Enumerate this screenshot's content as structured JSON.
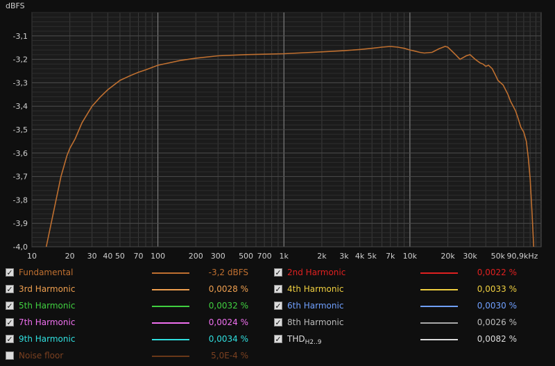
{
  "chart_data": {
    "type": "line",
    "ylabel": "dBFS",
    "x_scale": "log",
    "xlim": [
      10,
      110000
    ],
    "ylim": [
      -4.0,
      -3.0
    ],
    "y_ticks": [
      "-3,1",
      "-3,2",
      "-3,3",
      "-3,4",
      "-3,5",
      "-3,6",
      "-3,7",
      "-3,8",
      "-3,9",
      "-4,0"
    ],
    "y_tick_values": [
      -3.1,
      -3.2,
      -3.3,
      -3.4,
      -3.5,
      -3.6,
      -3.7,
      -3.8,
      -3.9,
      -4.0
    ],
    "x_ticks": [
      "10",
      "20",
      "30",
      "40",
      "50",
      "70",
      "100",
      "200",
      "300",
      "500",
      "700",
      "1k",
      "2k",
      "3k",
      "4k",
      "5k",
      "7k",
      "10k",
      "20k",
      "30k",
      "50k",
      "90,9kHz"
    ],
    "x_tick_values": [
      10,
      20,
      30,
      40,
      50,
      70,
      100,
      200,
      300,
      500,
      700,
      1000,
      2000,
      3000,
      4000,
      5000,
      7000,
      10000,
      20000,
      30000,
      50000,
      90900
    ],
    "grid": true,
    "background": "#1b1b1b",
    "series": [
      {
        "name": "Fundamental",
        "color": "#c07030",
        "x": [
          13,
          15,
          17,
          19,
          20,
          22,
          25,
          30,
          35,
          40,
          50,
          60,
          70,
          80,
          100,
          150,
          200,
          300,
          500,
          700,
          1000,
          2000,
          3000,
          4000,
          5000,
          6000,
          7000,
          8000,
          9000,
          10000,
          11000,
          12000,
          13000,
          15000,
          17000,
          19000,
          20000,
          23000,
          25000,
          28000,
          30000,
          33000,
          36000,
          38000,
          40000,
          42000,
          45000,
          48000,
          50000,
          55000,
          60000,
          63000,
          66000,
          69000,
          72000,
          76000,
          80000,
          84000,
          87000,
          90000,
          93000,
          96000
        ],
        "y": [
          -4.0,
          -3.84,
          -3.7,
          -3.61,
          -3.58,
          -3.54,
          -3.47,
          -3.4,
          -3.36,
          -3.33,
          -3.29,
          -3.27,
          -3.255,
          -3.245,
          -3.225,
          -3.205,
          -3.195,
          -3.185,
          -3.18,
          -3.178,
          -3.176,
          -3.168,
          -3.163,
          -3.158,
          -3.153,
          -3.148,
          -3.145,
          -3.148,
          -3.153,
          -3.16,
          -3.165,
          -3.17,
          -3.173,
          -3.17,
          -3.155,
          -3.145,
          -3.148,
          -3.18,
          -3.2,
          -3.185,
          -3.18,
          -3.2,
          -3.215,
          -3.22,
          -3.23,
          -3.225,
          -3.24,
          -3.27,
          -3.29,
          -3.31,
          -3.35,
          -3.38,
          -3.4,
          -3.42,
          -3.45,
          -3.49,
          -3.51,
          -3.55,
          -3.62,
          -3.71,
          -3.85,
          -4.0
        ]
      }
    ]
  },
  "legend": [
    {
      "checked": true,
      "name": "Fundamental",
      "value": "-3,2 dBFS",
      "color": "#c07030",
      "text_color": "#c07030",
      "line_color": "#c07030"
    },
    {
      "checked": true,
      "name": "2nd Harmonic",
      "value": "0,0022 %",
      "color": "#e02020",
      "text_color": "#e02020",
      "line_color": "#e02020"
    },
    {
      "checked": true,
      "name": "3rd Harmonic",
      "value": "0,0028 %",
      "color": "#f0a050",
      "text_color": "#f0a050",
      "line_color": "#f0a050"
    },
    {
      "checked": true,
      "name": "4th Harmonic",
      "value": "0,0033 %",
      "color": "#f0d040",
      "text_color": "#f0d040",
      "line_color": "#f0d040"
    },
    {
      "checked": true,
      "name": "5th Harmonic",
      "value": "0,0032 %",
      "color": "#40d040",
      "text_color": "#40d040",
      "line_color": "#40d040"
    },
    {
      "checked": true,
      "name": "6th Harmonic",
      "value": "0,0030 %",
      "color": "#70a0ff",
      "text_color": "#70a0ff",
      "line_color": "#70a0ff"
    },
    {
      "checked": true,
      "name": "7th Harmonic",
      "value": "0,0024 %",
      "color": "#f070f0",
      "text_color": "#f070f0",
      "line_color": "#f070f0"
    },
    {
      "checked": true,
      "name": "8th Harmonic",
      "value": "0,0026 %",
      "color": "#bbbbbb",
      "text_color": "#bbbbbb",
      "line_color": "#aaaaaa"
    },
    {
      "checked": true,
      "name": "9th Harmonic",
      "value": "0,0034 %",
      "color": "#30e0e0",
      "text_color": "#30e0e0",
      "line_color": "#30e0e0"
    },
    {
      "checked": true,
      "name": "THD",
      "name_sub": "H2..9",
      "value": "0,0082 %",
      "color": "#dddddd",
      "text_color": "#dddddd",
      "line_color": "#dddddd"
    },
    {
      "checked": false,
      "name": "Noise floor",
      "value": "5,0E-4 %",
      "color": "#7a4020",
      "text_color": "#7a4020",
      "line_color": "#6a3818"
    }
  ]
}
